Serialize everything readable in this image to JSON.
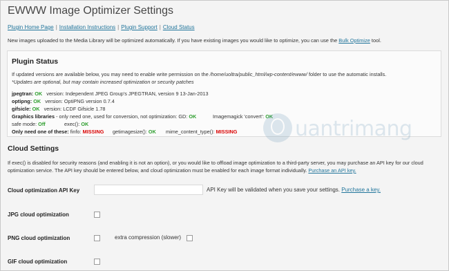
{
  "page": {
    "title": "EWWW Image Optimizer Settings",
    "links": [
      "Plugin Home Page",
      "Installation Instructions",
      "Plugin Support",
      "Cloud Status"
    ],
    "intro": {
      "pre": "New images uploaded to the Media Library will be optimized automatically. If you have existing images you would like to optimize, you can use the ",
      "link": "Bulk Optimize",
      "post": " tool."
    }
  },
  "plugin_status": {
    "heading": "Plugin Status",
    "note_pre": "If updated versions are available below, you may need to enable write permission on the ",
    "note_path": "/home/uoltra/public_html/wp-content/ewww/",
    "note_post": " folder to use the automatic installs.",
    "note2": "*Updates are optional, but may contain increased optimization or security patches",
    "ok": "OK",
    "missing": "MISSING",
    "off": "Off",
    "jpegtran": {
      "name": "jpegtran:",
      "version": "version: Independent JPEG Group's JPEGTRAN, version 9 13-Jan-2013"
    },
    "optipng": {
      "name": "optipng:",
      "version": "version: OptiPNG version 0.7.4"
    },
    "gifsicle": {
      "name": "gifsicle:",
      "version": "version: LCDF Gifsicle 1.78"
    },
    "graphics": {
      "name": "Graphics libraries",
      "desc": " - only need one, used for conversion, not optimization: GD: ",
      "imagick": "Imagemagick 'convert': "
    },
    "safe_mode": "safe mode: ",
    "exec": "exec(): ",
    "only_need": "Only need one of these: ",
    "finfo": "finfo: ",
    "getimagesize": "getimagesize(): ",
    "mime": "mime_content_type(): "
  },
  "cloud": {
    "heading": "Cloud Settings",
    "desc": "If exec() is disabled for security reasons (and enabling it is not an option), or you would like to offload image optimization to a third-party server, you may purchase an API key for our cloud optimization service. The API key should be entered below, and cloud optimization must be enabled for each image format individually.",
    "desc_link": "Purchase an API key.",
    "api_label": "Cloud optimization API Key",
    "api_value": "",
    "api_note": "API Key will be validated when you save your settings.",
    "api_link": "Purchase a key.",
    "jpg_label": "JPG cloud optimization",
    "png_label": "PNG cloud optimization",
    "extra_label": "extra compression (slower)",
    "gif_label": "GIF cloud optimization",
    "jpg_checked": false,
    "png_checked": false,
    "extra_checked": false,
    "gif_checked": false
  },
  "watermark": {
    "text": "uantrimang"
  },
  "colors": {
    "link": "#21759b",
    "ok": "#2e9e2e",
    "missing": "#d90000"
  }
}
